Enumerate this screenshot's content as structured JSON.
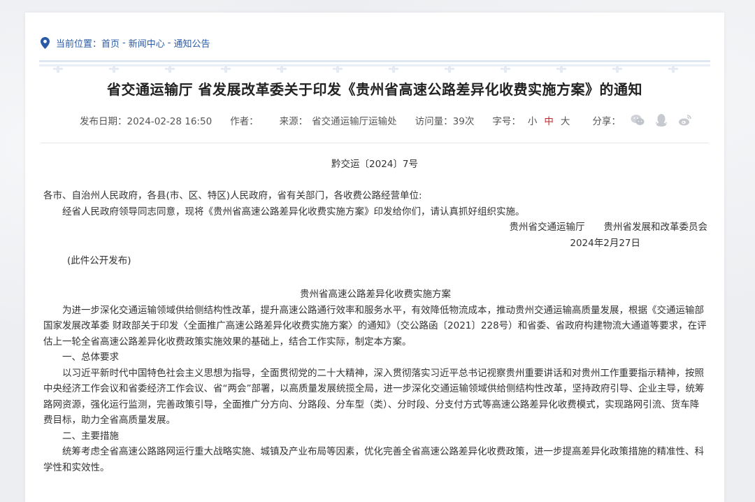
{
  "breadcrumb": {
    "label": "当前位置：",
    "items": [
      "首页",
      "新闻中心",
      "通知公告"
    ],
    "separator": "-"
  },
  "article": {
    "title": "省交通运输厅 省发展改革委关于印发《贵州省高速公路差异化收费实施方案》的通知",
    "meta": {
      "publish_label": "发布日期：",
      "publish_date": "2024-02-28 16:50",
      "author_label": "作者：",
      "author": "",
      "source_label": "来源：",
      "source": "省交通运输厅运输处",
      "views_label": "访问量：",
      "views": "39次",
      "font_label": "字号：",
      "font_sizes": [
        "小",
        "中",
        "大"
      ],
      "share_label": "分享："
    },
    "share_icons": [
      "wechat-icon",
      "qq-icon",
      "weibo-icon"
    ],
    "doc_number": "黔交运〔2024〕7号",
    "addressee": "各市、自治州人民政府，各县(市、区、特区)人民政府，省有关部门，各收费公路经营单位:",
    "intro": "经省人民政府领导同志同意，现将《贵州省高速公路差异化收费实施方案》印发给你们，请认真抓好组织实施。",
    "signers": "贵州省交通运输厅　　贵州省发展和改革委员会",
    "sign_date": "2024年2月27日",
    "note": "(此件公开发布)",
    "plan_title": "贵州省高速公路差异化收费实施方案",
    "para1": "为进一步深化交通运输领域供给侧结构性改革，提升高速公路通行效率和服务水平，有效降低物流成本，推动贵州交通运输高质量发展，根据《交通运输部国家发展改革委 财政部关于印发〈全面推广高速公路差异化收费实施方案〉的通知》（交公路函〔2021〕228号）和省委、省政府构建物流大通道等要求，在评估上一轮全省高速公路差异化收费政策实施效果的基础上，结合工作实际，制定本方案。",
    "heading1": "一、总体要求",
    "para2": "以习近平新时代中国特色社会主义思想为指导，全面贯彻党的二十大精神，深入贯彻落实习近平总书记视察贵州重要讲话和对贵州工作重要指示精神，按照中央经济工作会议和省委经济工作会议、省“两会”部署，以高质量发展统揽全局，进一步深化交通运输领域供给侧结构性改革，坚持政府引导、企业主导，统筹路网资源，强化运行监测，完善政策引导，全面推广分方向、分路段、分车型（类）、分时段、分支付方式等高速公路差异化收费模式，实现路网引流、货车降费目标，助力全省高质量发展。",
    "heading2": "二、主要措施",
    "para3": "统筹考虑全省高速公路路网运行重大战略实施、城镇及产业布局等因素，优化完善全省高速公路差异化收费政策，进一步提高差异化政策措施的精准性、科学性和实效性。"
  },
  "colors": {
    "link": "#2a5aa5",
    "active_font": "#c0272d",
    "text": "#333333",
    "background": "#eceef1"
  }
}
